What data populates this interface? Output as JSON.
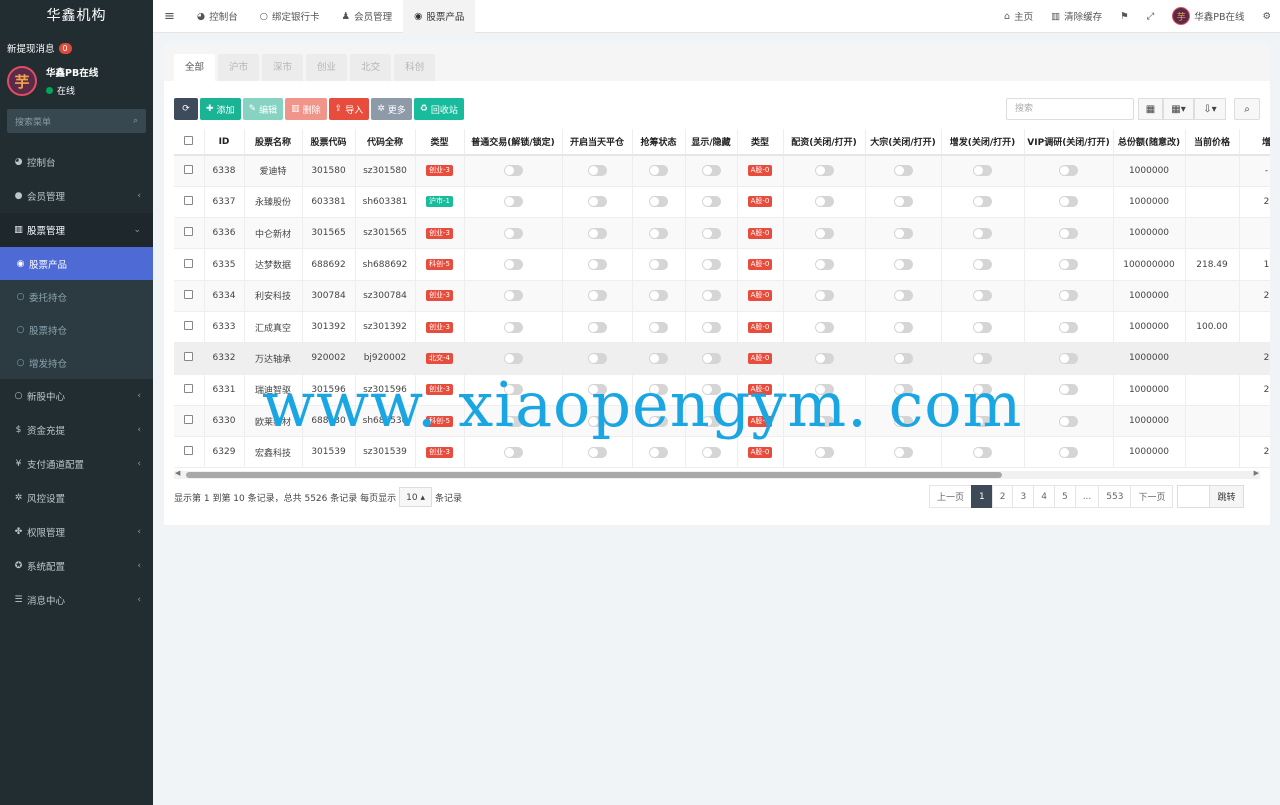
{
  "brand": "华鑫机构",
  "notice": {
    "label": "新提现消息",
    "count": "0"
  },
  "user": {
    "name": "华鑫PB在线",
    "status": "在线",
    "avatar_char": "芋"
  },
  "sidebar_search": "搜索菜单",
  "menu": [
    {
      "label": "控制台",
      "icon": "dashboard-icon",
      "glyph": "◕"
    },
    {
      "label": "会员管理",
      "icon": "user-circle-icon",
      "glyph": "●",
      "arrow": "‹"
    },
    {
      "label": "股票管理",
      "icon": "bank-icon",
      "glyph": "▥",
      "arrow": "⌄"
    },
    {
      "label": "股票产品",
      "icon": "circle-dot-icon",
      "glyph": "◉"
    },
    {
      "label": "委托持仓",
      "icon": "circle-icon",
      "glyph": "○"
    },
    {
      "label": "股票持仓",
      "icon": "circle-icon",
      "glyph": "○"
    },
    {
      "label": "增发持仓",
      "icon": "circle-icon",
      "glyph": "○"
    },
    {
      "label": "新股中心",
      "icon": "circle-icon",
      "glyph": "○",
      "arrow": "‹"
    },
    {
      "label": "资金充提",
      "icon": "dollar-icon",
      "glyph": "$",
      "arrow": "‹"
    },
    {
      "label": "支付通道配置",
      "icon": "yen-icon",
      "glyph": "¥",
      "arrow": "‹"
    },
    {
      "label": "风控设置",
      "icon": "gear-icon",
      "glyph": "✲"
    },
    {
      "label": "权限管理",
      "icon": "users-icon",
      "glyph": "✤",
      "arrow": "‹"
    },
    {
      "label": "系统配置",
      "icon": "cog-icon",
      "glyph": "✪",
      "arrow": "‹"
    },
    {
      "label": "消息中心",
      "icon": "list-icon",
      "glyph": "☰",
      "arrow": "‹"
    }
  ],
  "topbar": {
    "menu_toggle": "≡",
    "tabs": [
      {
        "label": "控制台",
        "icon": "dashboard-icon",
        "glyph": "◕"
      },
      {
        "label": "绑定银行卡",
        "icon": "circle-icon",
        "glyph": "○"
      },
      {
        "label": "会员管理",
        "icon": "user-icon",
        "glyph": "♟"
      },
      {
        "label": "股票产品",
        "icon": "circle-dot-icon",
        "glyph": "◉"
      }
    ],
    "right": [
      {
        "label": "主页",
        "icon": "home-icon",
        "glyph": "⌂"
      },
      {
        "label": "清除缓存",
        "icon": "trash-icon",
        "glyph": "▥"
      },
      {
        "label": "",
        "icon": "language-icon",
        "glyph": "⚑"
      },
      {
        "label": "",
        "icon": "fullscreen-icon",
        "glyph": "⤢"
      }
    ],
    "user_name": "华鑫PB在线",
    "settings_glyph": "⚙"
  },
  "market_tabs": [
    "全部",
    "沪市",
    "深市",
    "创业",
    "北交",
    "科创"
  ],
  "toolbar": {
    "refresh": "⟳",
    "add": "添加",
    "edit": "编辑",
    "delete": "删除",
    "import": "导入",
    "more": "更多",
    "recycle": "回收站",
    "search_placeholder": "搜索"
  },
  "table": {
    "headers": [
      "ID",
      "股票名称",
      "股票代码",
      "代码全称",
      "类型",
      "普通交易(解锁/锁定)",
      "开启当天平仓",
      "抢筹状态",
      "显示/隐藏",
      "类型",
      "配资(关闭/打开)",
      "大宗(关闭/打开)",
      "增发(关闭/打开)",
      "VIP调研(关闭/打开)",
      "总份额(随意改)",
      "当前价格",
      "增"
    ],
    "rows": [
      {
        "id": "6338",
        "name": "爱迪特",
        "code": "301580",
        "full": "sz301580",
        "type": "创业-3",
        "type_color": "red",
        "type2": "A股-0",
        "total": "1000000",
        "price": "",
        "extra": "-"
      },
      {
        "id": "6337",
        "name": "永臻股份",
        "code": "603381",
        "full": "sh603381",
        "type": "沪市-1",
        "type_color": "green",
        "type2": "A股-0",
        "total": "1000000",
        "price": "",
        "extra": "2"
      },
      {
        "id": "6336",
        "name": "中仑新材",
        "code": "301565",
        "full": "sz301565",
        "type": "创业-3",
        "type_color": "red",
        "type2": "A股-0",
        "total": "1000000",
        "price": "",
        "extra": ""
      },
      {
        "id": "6335",
        "name": "达梦数据",
        "code": "688692",
        "full": "sh688692",
        "type": "科创-5",
        "type_color": "red",
        "type2": "A股-0",
        "total": "100000000",
        "price": "218.49",
        "extra": "1"
      },
      {
        "id": "6334",
        "name": "利安科技",
        "code": "300784",
        "full": "sz300784",
        "type": "创业-3",
        "type_color": "red",
        "type2": "A股-0",
        "total": "1000000",
        "price": "",
        "extra": "2"
      },
      {
        "id": "6333",
        "name": "汇成真空",
        "code": "301392",
        "full": "sz301392",
        "type": "创业-3",
        "type_color": "red",
        "type2": "A股-0",
        "total": "1000000",
        "price": "100.00",
        "extra": ""
      },
      {
        "id": "6332",
        "name": "万达轴承",
        "code": "920002",
        "full": "bj920002",
        "type": "北交-4",
        "type_color": "red",
        "type2": "A股-0",
        "total": "1000000",
        "price": "",
        "extra": "2"
      },
      {
        "id": "6331",
        "name": "瑞迪智驱",
        "code": "301596",
        "full": "sz301596",
        "type": "创业-3",
        "type_color": "red",
        "type2": "A股-0",
        "total": "1000000",
        "price": "",
        "extra": "2"
      },
      {
        "id": "6330",
        "name": "欧莱新材",
        "code": "688530",
        "full": "sh688530",
        "type": "科创-5",
        "type_color": "red",
        "type2": "A股-0",
        "total": "1000000",
        "price": "",
        "extra": ""
      },
      {
        "id": "6329",
        "name": "宏鑫科技",
        "code": "301539",
        "full": "sz301539",
        "type": "创业-3",
        "type_color": "red",
        "type2": "A股-0",
        "total": "1000000",
        "price": "",
        "extra": "2"
      }
    ]
  },
  "pagination": {
    "info_prefix": "显示第 1 到第 10 条记录，总共 5526 条记录 每页显示",
    "page_size": "10",
    "info_suffix": "条记录",
    "prev": "上一页",
    "next": "下一页",
    "pages": [
      "1",
      "2",
      "3",
      "4",
      "5",
      "...",
      "553"
    ],
    "jump": "跳转"
  },
  "watermark": "www. xiaopengym. com",
  "colors": {
    "sidebar_bg": "#222d32",
    "active_menu": "#4e6ad4",
    "tag_red": "#e74c3c",
    "tag_green": "#18bc9c"
  }
}
